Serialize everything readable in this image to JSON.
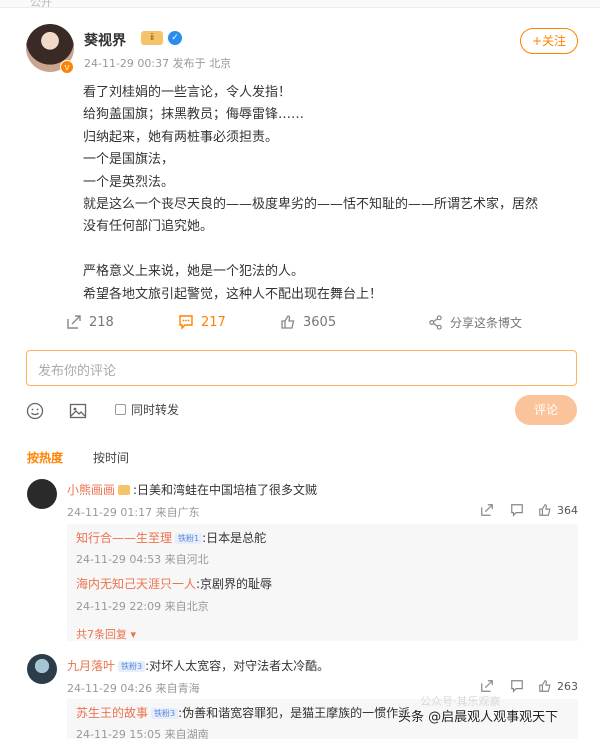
{
  "top": {
    "label": "公开"
  },
  "post": {
    "author": "葵视界",
    "vip_badge": "ⅱ",
    "verified_mark": "v",
    "meta": "24-11-29 00:37 发布于 北京",
    "follow_label": "+关注",
    "lines": [
      "看了刘桂娟的一些言论，令人发指！",
      "给狗盖国旗；抹黑教员；侮辱雷锋……",
      "归纳起来，她有两桩事必须担责。",
      "一个是国旗法，",
      "一个是英烈法。",
      "就是这么一个丧尽天良的——极度卑劣的——恬不知耻的——所谓艺术家，居然",
      "没有任何部门追究她。",
      "",
      "严格意义上来说，她是一个犯法的人。",
      "希望各地文旅引起警觉，这种人不配出现在舞台上！"
    ],
    "repost_count": "218",
    "comment_count": "217",
    "like_count": "3605",
    "share_label": "分享这条博文"
  },
  "composer": {
    "placeholder": "发布你的评论",
    "forward_label": "同时转发",
    "submit_label": "评论"
  },
  "sort": {
    "hot": "按热度",
    "time": "按时间"
  },
  "comments": [
    {
      "user": "小熊画画",
      "text": ":日美和湾蛙在中国培植了很多文贼",
      "meta": "24-11-29 01:17 来自广东",
      "likes": "364",
      "replies": [
        {
          "user": "知行合——生至理",
          "level": "铁粉1",
          "text": ":日本是总舵",
          "meta": "24-11-29 04:53 来自河北"
        },
        {
          "user": "海内无知己天涯只一人",
          "text": ":京剧界的耻辱",
          "meta": "24-11-29 22:09 来自北京"
        }
      ],
      "more_label": "共7条回复"
    },
    {
      "user": "九月落叶",
      "level": "铁粉3",
      "text": ":对坏人太宽容，对守法者太冷酷。",
      "meta": "24-11-29 04:26 来自青海",
      "likes": "263",
      "replies": [
        {
          "user": "苏生王的故事",
          "level": "铁粉3",
          "text": ":伪善和谐宽容罪犯，是猫王摩族的一惯作派",
          "meta": "24-11-29 15:05 来自湖南"
        }
      ]
    }
  ],
  "watermark": {
    "text": "头条 @启晨观人观事观天下",
    "faint": "公众号·其乐观察"
  }
}
